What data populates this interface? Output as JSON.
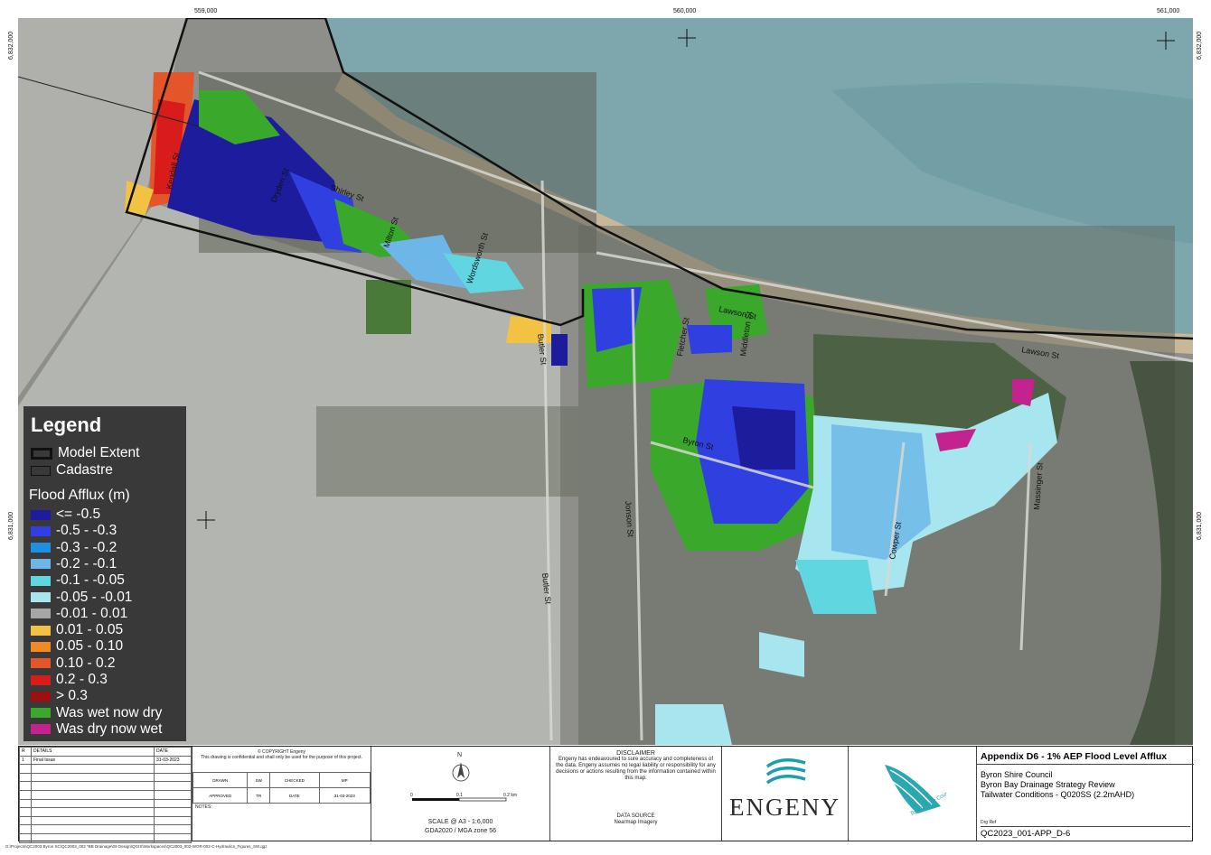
{
  "grid": {
    "easting_labels": [
      "559,000",
      "560,000",
      "561,000"
    ],
    "northing_labels": [
      "6,832,000",
      "6,831,000"
    ]
  },
  "streets": [
    "Kendall St",
    "Dryden St",
    "Shirley St",
    "Milton St",
    "Wordsworth St",
    "Butler St",
    "Lawson St",
    "Fletcher St",
    "Middleton St",
    "Byron St",
    "Jonson St",
    "Cowper St",
    "Massinger St",
    "Butler St",
    "Lawson St"
  ],
  "legend": {
    "title": "Legend",
    "model_extent": "Model Extent",
    "cadastre": "Cadastre",
    "flood_title": "Flood Afflux (m)",
    "classes": [
      {
        "label": "<= -0.5",
        "color": "#1c1c9c"
      },
      {
        "label": "-0.5 - -0.3",
        "color": "#2f3fe0"
      },
      {
        "label": "-0.3 - -0.2",
        "color": "#1f8fe0"
      },
      {
        "label": "-0.2 - -0.1",
        "color": "#6cb7e8"
      },
      {
        "label": "-0.1 - -0.05",
        "color": "#5fd6e0"
      },
      {
        "label": "-0.05 - -0.01",
        "color": "#a7e6ee"
      },
      {
        "label": "-0.01 - 0.01",
        "color": "#a6a6a6"
      },
      {
        "label": "0.01 - 0.05",
        "color": "#f2c244"
      },
      {
        "label": "0.05 - 0.10",
        "color": "#f08a24"
      },
      {
        "label": "0.10 - 0.2",
        "color": "#e4562a"
      },
      {
        "label": "0.2 - 0.3",
        "color": "#d81c1c"
      },
      {
        "label": "> 0.3",
        "color": "#9e0f0f"
      },
      {
        "label": "Was wet now dry",
        "color": "#3aa82a"
      },
      {
        "label": "Was dry now wet",
        "color": "#c4228e"
      }
    ]
  },
  "titleblock": {
    "rev_header": {
      "r": "R",
      "details": "DETAILS",
      "date": "DATE"
    },
    "rev_rows": [
      {
        "r": "1",
        "details": "Final Issue",
        "date": "31-03-2023"
      }
    ],
    "copyright": "© COPYRIGHT Engeny",
    "confidential": "This drawing is confidential and shall only be used for the purpose of this project.",
    "sig": {
      "drawn": "DRAWN",
      "drawn_by": "SW",
      "checked": "CHECKED",
      "checked_by": "MP",
      "approved": "APPROVED",
      "approved_by": "TR",
      "date_label": "DATE",
      "date": "31-03-2023"
    },
    "notes": "NOTES:",
    "north": "N",
    "scale_ticks": [
      "0",
      "0.1",
      "0.2 km"
    ],
    "scale": "SCALE @ A3 - 1:6,000",
    "datum": "GDA2020 / MGA zone 56",
    "disclaimer_title": "DISCLAIMER",
    "disclaimer": "Engeny has endeavoured to sure accuracy and completeness of the data. Engeny assumes no legal liability or responsibility for any decisions or actions resulting from the information contained within this map.",
    "source_title": "DATA SOURCE",
    "source": "Nearmap Imagery",
    "engeny": "ENGENY",
    "council_logo": "Byron Shire Council",
    "map_title": "Appendix D6 - 1% AEP Flood Level Afflux",
    "client": "Byron Shire Council",
    "project": "Byron Bay Drainage Strategy Review",
    "scenario": "Tailwater Conditions - Q020SS (2.2mAHD)",
    "dwg_label": "Drg Ref",
    "drawing_no": "QC2023_001-APP_D-6"
  },
  "file_path": "G:\\Projects\\QC2003 Byron SC\\QC2003_002 *BB Drainage\\09 Design\\QGIS\\Workspaces\\QC2003_002-WOR-002-C-Hydraulics_Figures_SW.qgz"
}
